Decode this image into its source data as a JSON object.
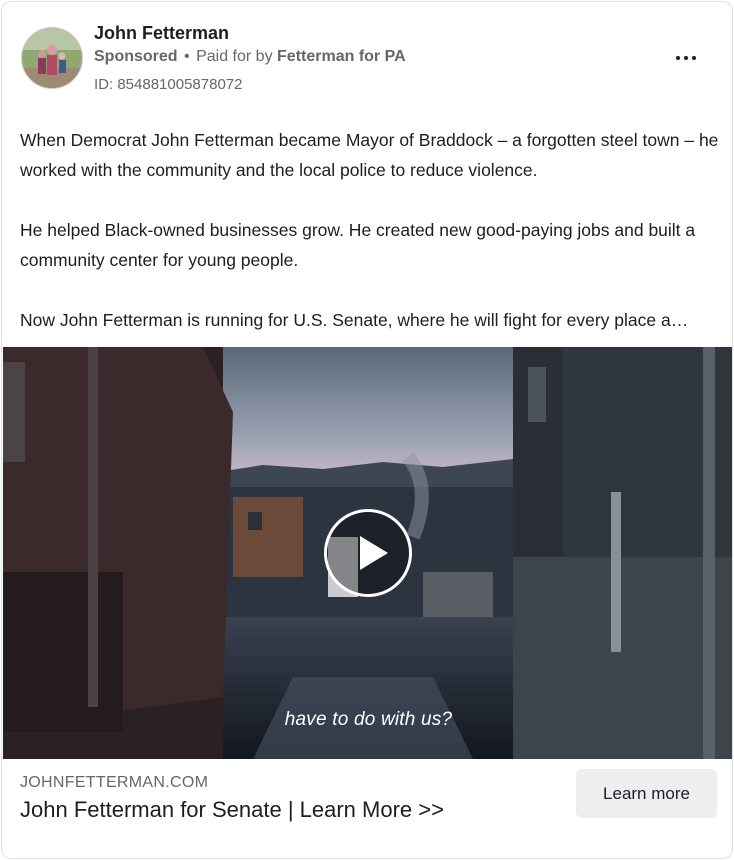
{
  "advertiser": {
    "name": "John Fetterman",
    "sponsored_label": "Sponsored",
    "separator": "•",
    "paid_for_prefix": "Paid for by",
    "paid_for_by": "Fetterman for PA",
    "ad_id": "ID: 854881005878072"
  },
  "menu": {
    "icon": "more-options-icon"
  },
  "post": {
    "paragraphs": [
      "When Democrat John Fetterman became Mayor of Braddock – a forgotten steel town – he worked with the community and the local police to reduce violence.",
      "He helped Black-owned businesses grow. He created new good-paying jobs and built a community center for young people.",
      "Now John Fetterman is running for U.S. Senate, where he will fight for every place a…"
    ]
  },
  "video": {
    "subtitle": "have to do with us?",
    "play_icon": "play-icon"
  },
  "link": {
    "domain": "JOHNFETTERMAN.COM",
    "headline": "John Fetterman for Senate | Learn More >>",
    "cta_label": "Learn more"
  }
}
